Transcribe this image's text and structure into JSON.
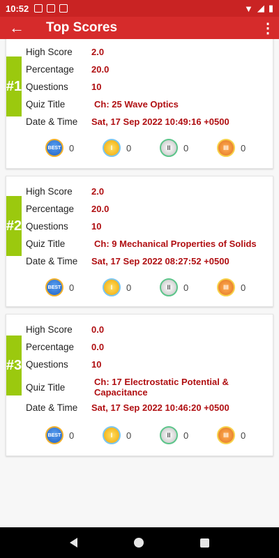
{
  "status": {
    "time": "10:52"
  },
  "appbar": {
    "title": "Top Scores",
    "back_icon": "←",
    "more_icon": "⋮"
  },
  "labels": {
    "high_score": "High Score",
    "percentage": "Percentage",
    "questions": "Questions",
    "quiz_title": "Quiz Title",
    "date_time": "Date & Time"
  },
  "cards": [
    {
      "rank": "#1",
      "high_score": "2.0",
      "percentage": "20.0",
      "questions": "10",
      "quiz_title": "Ch: 25 Wave Optics",
      "date_time": "Sat, 17 Sep 2022 10:49:16 +0500",
      "medals": {
        "best": "0",
        "gold": "0",
        "silver": "0",
        "bronze": "0"
      }
    },
    {
      "rank": "#2",
      "high_score": "2.0",
      "percentage": "20.0",
      "questions": "10",
      "quiz_title": "Ch: 9 Mechanical Properties of Solids",
      "date_time": "Sat, 17 Sep 2022 08:27:52 +0500",
      "medals": {
        "best": "0",
        "gold": "0",
        "silver": "0",
        "bronze": "0"
      }
    },
    {
      "rank": "#3",
      "high_score": "0.0",
      "percentage": "0.0",
      "questions": "10",
      "quiz_title": "Ch: 17 Electrostatic Potential & Capacitance",
      "date_time": "Sat, 17 Sep 2022 10:46:20 +0500",
      "medals": {
        "best": "0",
        "gold": "0",
        "silver": "0",
        "bronze": "0"
      }
    }
  ],
  "medal_icons": {
    "best": "BEST",
    "gold": "I",
    "silver": "II",
    "bronze": "III"
  },
  "colors": {
    "appbar": "#d62b2b",
    "rank_bar": "#9bc90e",
    "value_text": "#b00f12"
  }
}
